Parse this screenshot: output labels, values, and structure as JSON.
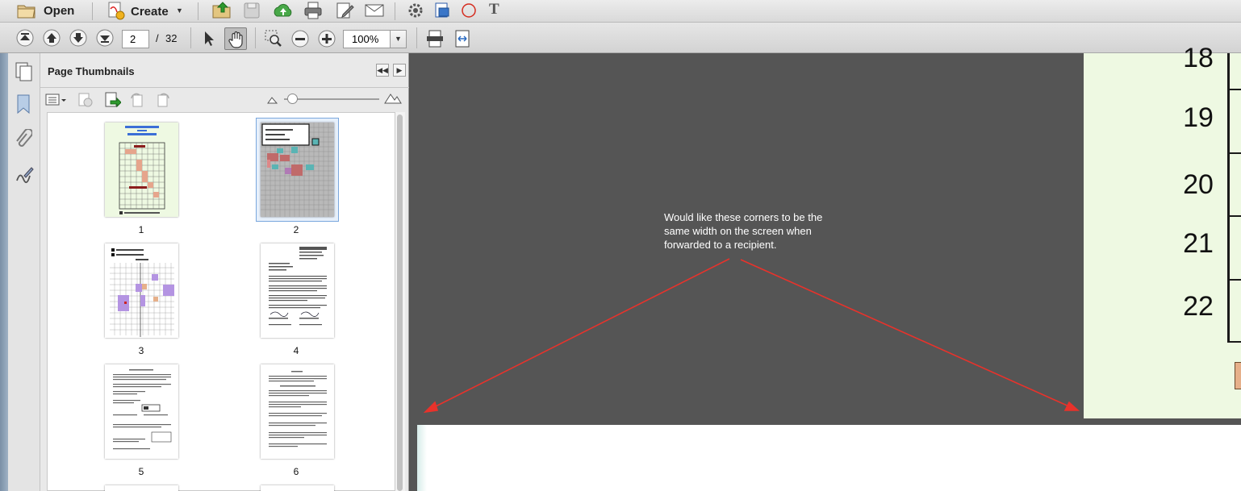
{
  "toolbar": {
    "open_label": "Open",
    "create_label": "Create",
    "page_current": "2",
    "page_separator": "/",
    "page_total": "32",
    "zoom_value": "100%"
  },
  "panel": {
    "title": "Page Thumbnails",
    "thumbnails": [
      {
        "label": "1"
      },
      {
        "label": "2"
      },
      {
        "label": "3"
      },
      {
        "label": "4"
      },
      {
        "label": "5"
      },
      {
        "label": "6"
      }
    ]
  },
  "document": {
    "annotation_text": "Would like these corners to be the same width on the screen when forwarded to a recipient.",
    "row_labels": [
      "18",
      "19",
      "20",
      "21",
      "22"
    ]
  },
  "colors": {
    "annotation_arrow": "#e8322b",
    "document_background": "#555555",
    "page_fill": "#eef9e2"
  },
  "icons": [
    "open-folder-icon",
    "create-pdf-icon",
    "open-file-icon",
    "save-icon",
    "upload-icon",
    "print-icon",
    "edit-icon",
    "email-icon",
    "settings-icon",
    "export-icon",
    "record-icon",
    "text-icon",
    "first-page-icon",
    "previous-page-icon",
    "next-page-icon",
    "last-page-icon",
    "select-tool-icon",
    "hand-tool-icon",
    "marquee-zoom-icon",
    "zoom-out-icon",
    "zoom-in-icon",
    "fit-page-icon",
    "fit-width-icon",
    "pages-icon",
    "bookmark-icon",
    "attachment-icon",
    "signature-icon"
  ]
}
